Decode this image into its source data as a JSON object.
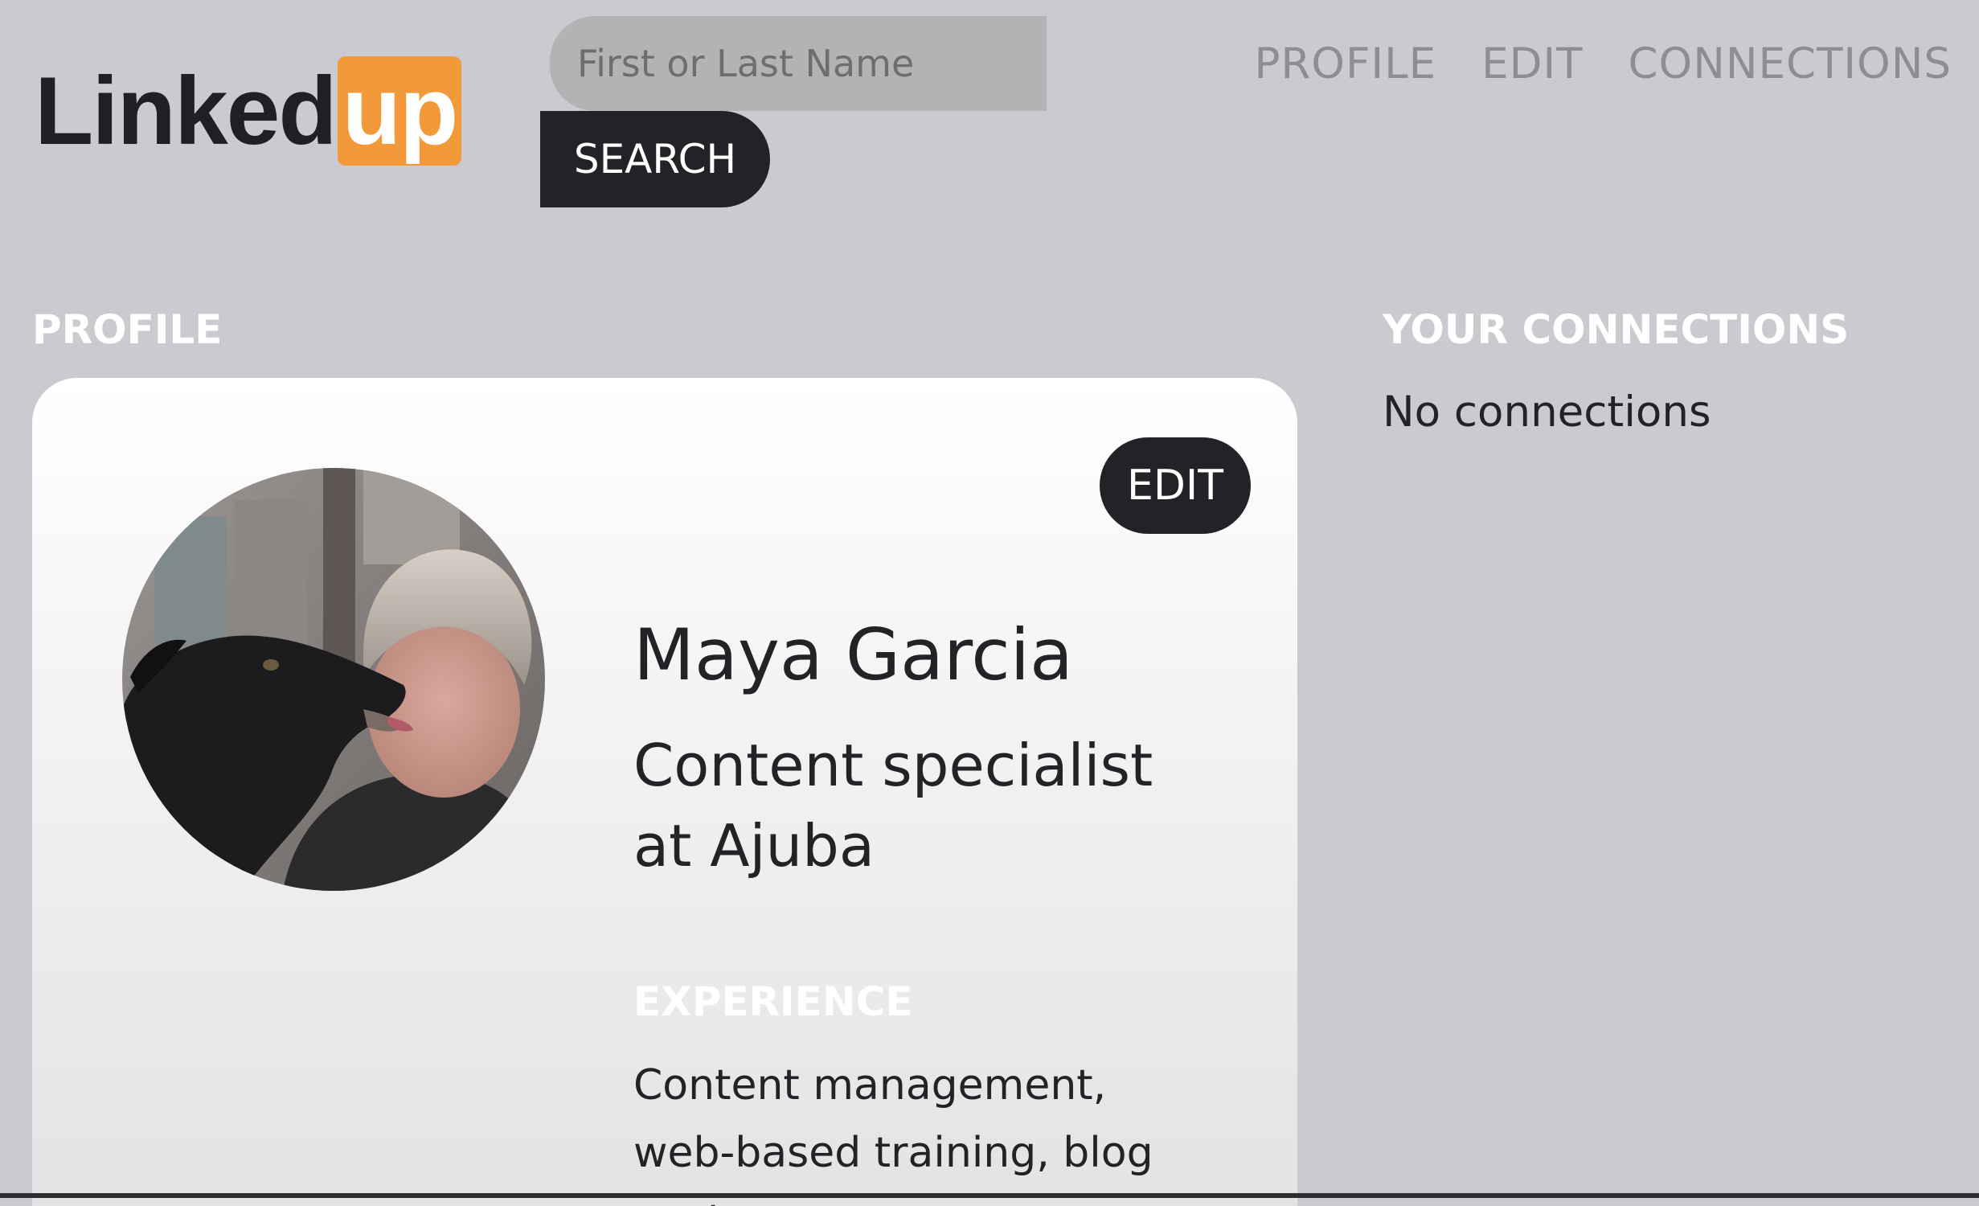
{
  "header": {
    "logo": {
      "main": "Linked",
      "badge": "up"
    },
    "search": {
      "placeholder": "First or Last Name",
      "value": "",
      "button_label": "SEARCH"
    },
    "nav": [
      {
        "label": "PROFILE"
      },
      {
        "label": "EDIT"
      },
      {
        "label": "CONNECTIONS"
      }
    ]
  },
  "profile": {
    "heading": "PROFILE",
    "edit_label": "EDIT",
    "name": "Maya Garcia",
    "title": "Content specialist at Ajuba",
    "experience_heading": "EXPERIENCE",
    "experience_text": "Content management, web-based training, blog post",
    "avatar": "profile-photo"
  },
  "connections": {
    "heading": "YOUR CONNECTIONS",
    "empty_text": "No connections"
  },
  "colors": {
    "background": "#cacbd1",
    "dark": "#222327",
    "brand_orange": "#f29a3a",
    "nav_text": "#8d8e93",
    "search_bg": "#b3b3b3"
  }
}
